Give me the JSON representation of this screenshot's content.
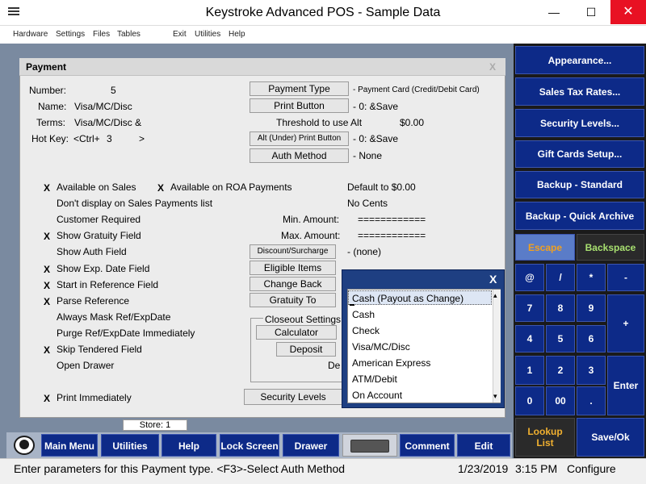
{
  "window": {
    "title": "Keystroke Advanced POS - Sample Data",
    "minimize": "—",
    "maximize": "☐",
    "close": "✕"
  },
  "menu": [
    "Hardware",
    "Settings",
    "Files",
    "Tables",
    "Exit",
    "Utilities",
    "Help"
  ],
  "payment": {
    "title": "Payment",
    "close": "X",
    "number_label": "Number:",
    "number_value": "5",
    "name_label": "Name:",
    "name_value": "Visa/MC/Disc",
    "terms_label": "Terms:",
    "terms_value": "Visa/MC/Disc &",
    "hotkey_label": "Hot Key:",
    "hotkey_prefix": "<Ctrl+",
    "hotkey_value": "3",
    "hotkey_suffix": ">",
    "payment_type_btn": "Payment Type",
    "payment_type_value": "- Payment Card (Credit/Debit Card)",
    "print_btn": "Print Button",
    "print_value": "- 0: &Save",
    "threshold_label": "Threshold to use Alt",
    "threshold_value": "$0.00",
    "alt_print_btn": "Alt (Under) Print Button",
    "alt_print_value": "- 0: &Save",
    "auth_btn": "Auth Method",
    "auth_value": "-  None",
    "x_mark": "X",
    "available_sales": "Available on Sales",
    "available_roa": "Available on ROA Payments",
    "default_label": "Default to $0.00",
    "dont_display": "Don't display on Sales Payments list",
    "no_cents": "No Cents",
    "customer_required": "Customer Required",
    "min_amount_label": "Min. Amount:",
    "min_amount_value": "============",
    "show_gratuity": "Show Gratuity Field",
    "max_amount_label": "Max. Amount:",
    "max_amount_value": "============",
    "show_auth": "Show Auth Field",
    "discount_btn": "Discount/Surcharge",
    "discount_value": "- (none)",
    "show_exp": "Show Exp. Date Field",
    "eligible_btn": "Eligible Items",
    "start_ref": "Start in Reference Field",
    "change_back_btn": "Change Back",
    "parse_ref": "Parse Reference",
    "gratuity_to_btn": "Gratuity To",
    "always_mask": "Always Mask Ref/ExpDate",
    "closeout_label": "Closeout Settings",
    "purge_ref": "Purge Ref/ExpDate Immediately",
    "calculator_btn": "Calculator",
    "skip_tendered": "Skip Tendered Field",
    "deposit_btn": "Deposit",
    "open_drawer": "Open Drawer",
    "de_fragment": "De",
    "print_immediately": "Print Immediately",
    "security_btn": "Security Levels"
  },
  "popup": {
    "close": "X",
    "items": [
      "Cash (Payout as Change)",
      "Cash",
      "Check",
      "Visa/MC/Disc",
      "American Express",
      "ATM/Debit",
      "On Account"
    ],
    "scroll_up": "▴",
    "scroll_down": "▾"
  },
  "right_panel": {
    "appearance": "Appearance...",
    "sales_tax": "Sales Tax Rates...",
    "security": "Security Levels...",
    "gift_cards": "Gift Cards Setup...",
    "backup_standard": "Backup - Standard",
    "backup_quick": "Backup - Quick Archive",
    "escape": "Escape",
    "backspace": "Backspace",
    "keys": [
      "@",
      "/",
      "*",
      "-",
      "7",
      "8",
      "9",
      "+",
      "4",
      "5",
      "6",
      "1",
      "2",
      "3",
      "Enter",
      "0",
      "00",
      "."
    ],
    "lookup": "Lookup List",
    "save_ok": "Save/Ok"
  },
  "bottom": {
    "store": "Store: 1",
    "main_menu": "Main Menu",
    "utilities": "Utilities",
    "help": "Help",
    "lock_screen": "Lock Screen",
    "drawer": "Drawer",
    "comment": "Comment",
    "edit": "Edit"
  },
  "status": {
    "message": "Enter parameters for this Payment type. <F3>-Select Auth Method",
    "date": "1/23/2019",
    "time": "3:15 PM",
    "mode": "Configure"
  },
  "colors": {
    "button_blue": "#0d2a88",
    "escape_text": "#f0a020",
    "backspace_text": "#a8e070",
    "lookup_text": "#f0b030",
    "popup_blue": "#1e3f82"
  }
}
